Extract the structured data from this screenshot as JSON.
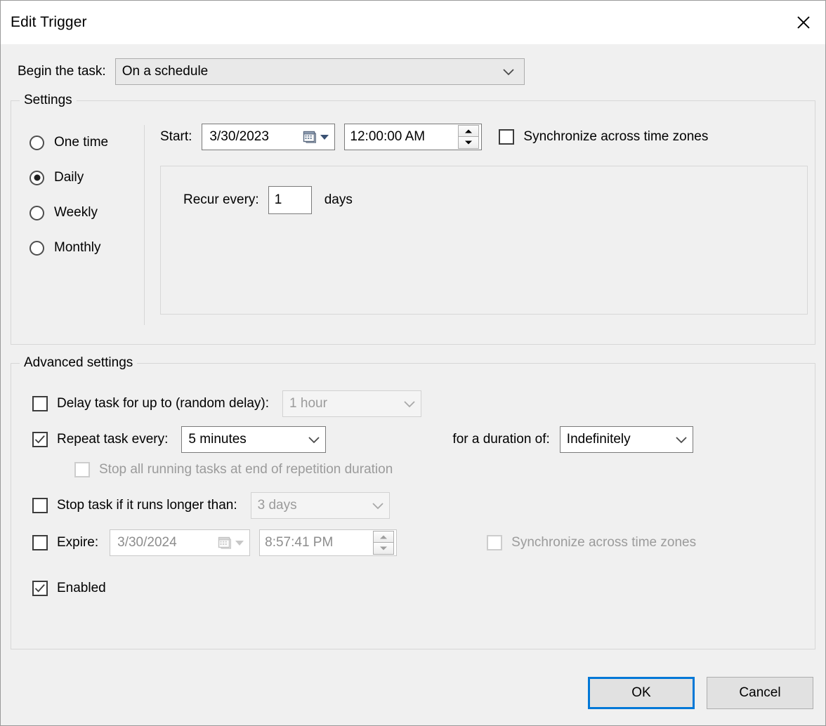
{
  "window": {
    "title": "Edit Trigger",
    "close_icon": "close-icon"
  },
  "begin_task": {
    "label": "Begin the task:",
    "value": "On a schedule",
    "chevron_icon": "chevron-down-icon"
  },
  "settings": {
    "legend": "Settings",
    "schedule_options": [
      {
        "label": "One time",
        "checked": false
      },
      {
        "label": "Daily",
        "checked": true
      },
      {
        "label": "Weekly",
        "checked": false
      },
      {
        "label": "Monthly",
        "checked": false
      }
    ],
    "start": {
      "label": "Start:",
      "date": "3/30/2023",
      "time": "12:00:00 AM",
      "calendar_icon": "calendar-icon",
      "dropdown_icon": "dropdown-triangle-icon",
      "spinner_up_icon": "spinner-up-icon",
      "spinner_down_icon": "spinner-down-icon"
    },
    "sync_time_zones": {
      "label": "Synchronize across time zones",
      "checked": false,
      "disabled": false
    },
    "recur": {
      "label": "Recur every:",
      "value": "1",
      "unit": "days"
    }
  },
  "advanced": {
    "legend": "Advanced settings",
    "delay_task": {
      "label": "Delay task for up to (random delay):",
      "checked": false,
      "value": "1 hour",
      "disabled": true
    },
    "repeat_task": {
      "label": "Repeat task every:",
      "checked": true,
      "value": "5 minutes",
      "disabled": false,
      "duration_label": "for a duration of:",
      "duration_value": "Indefinitely",
      "duration_disabled": false
    },
    "stop_all_running": {
      "label": "Stop all running tasks at end of repetition duration",
      "checked": false,
      "disabled": true
    },
    "stop_task_longer": {
      "label": "Stop task if it runs longer than:",
      "checked": false,
      "value": "3 days",
      "disabled": true
    },
    "expire": {
      "label": "Expire:",
      "checked": false,
      "date": "3/30/2024",
      "time": "8:57:41 PM",
      "disabled": true
    },
    "expire_sync_time_zones": {
      "label": "Synchronize across time zones",
      "checked": false,
      "disabled": true
    },
    "enabled": {
      "label": "Enabled",
      "checked": true,
      "disabled": false
    }
  },
  "footer": {
    "ok_label": "OK",
    "cancel_label": "Cancel"
  },
  "colors": {
    "accent": "#0078d7",
    "dialog_bg": "#f0f0f0",
    "disabled_text": "#9b9b9b"
  }
}
